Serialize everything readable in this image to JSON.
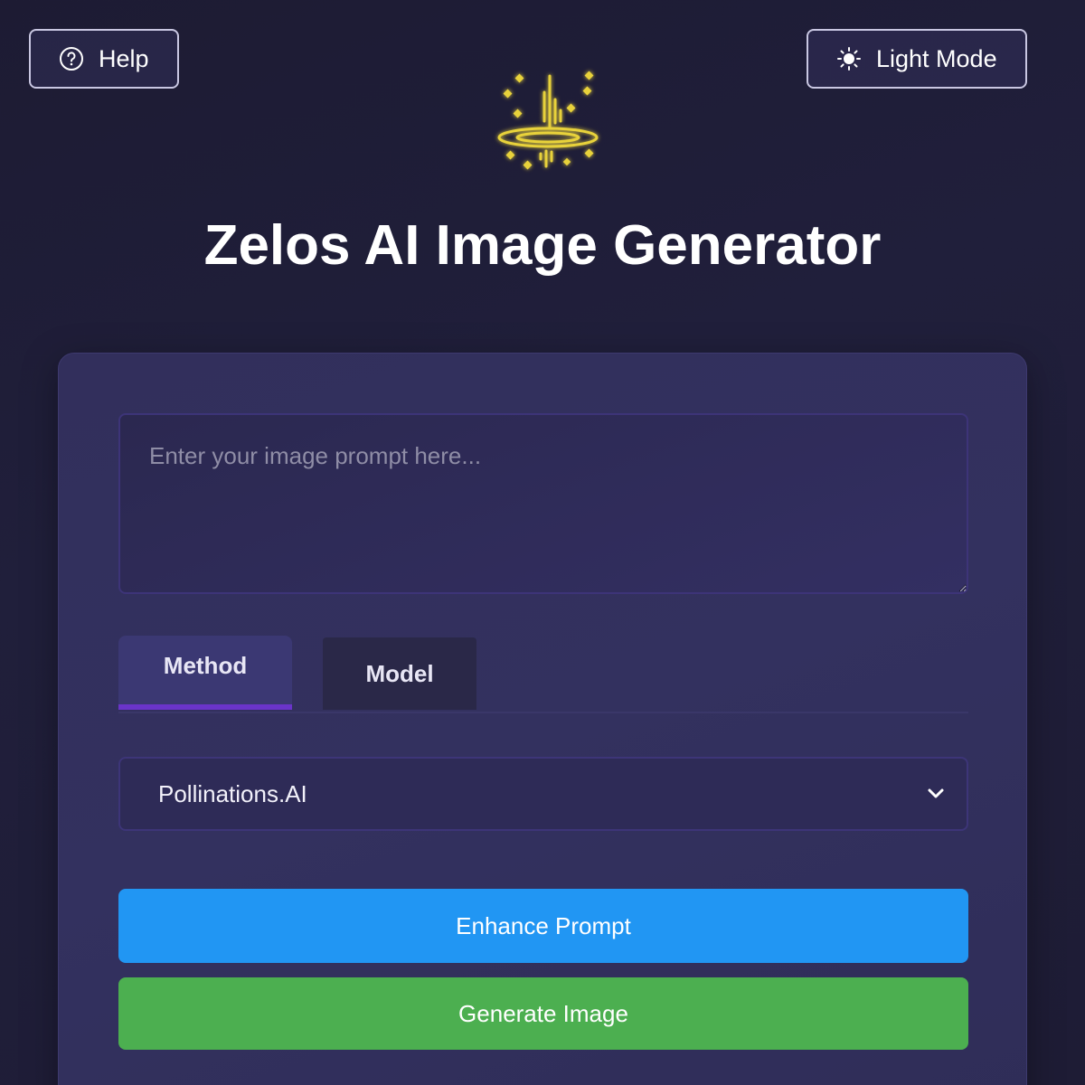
{
  "header": {
    "help_label": "Help",
    "theme_toggle_label": "Light Mode",
    "title": "Zelos AI Image Generator"
  },
  "form": {
    "prompt_placeholder": "Enter your image prompt here...",
    "prompt_value": "",
    "tabs": [
      {
        "label": "Method",
        "active": true
      },
      {
        "label": "Model",
        "active": false
      }
    ],
    "method_selected": "Pollinations.AI",
    "enhance_label": "Enhance Prompt",
    "generate_label": "Generate Image"
  },
  "colors": {
    "background": "#1f1d38",
    "card": "#33315f",
    "accent_tab": "#6a34c9",
    "enhance_button": "#2196f3",
    "generate_button": "#4caf50",
    "logo_gold": "#e8d23a"
  },
  "icons": {
    "help": "question-circle-icon",
    "theme": "sun-icon",
    "logo": "sparkle-portal-logo",
    "select": "chevron-down-icon"
  }
}
